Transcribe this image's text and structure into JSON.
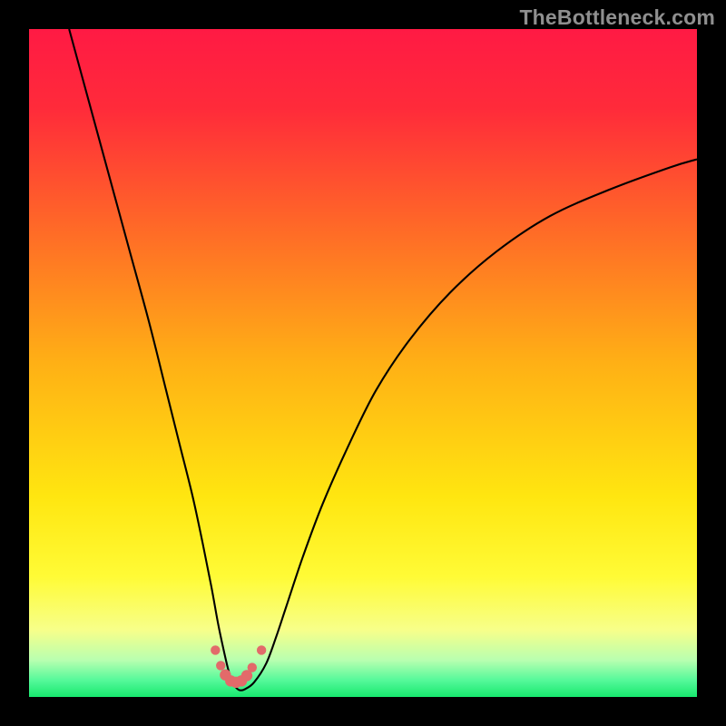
{
  "watermark": "TheBottleneck.com",
  "chart_data": {
    "type": "line",
    "title": "",
    "xlabel": "",
    "ylabel": "",
    "xlim": [
      0,
      100
    ],
    "ylim": [
      0,
      100
    ],
    "gradient_stops": [
      {
        "offset": 0.0,
        "color": "#ff1a44"
      },
      {
        "offset": 0.12,
        "color": "#ff2b3a"
      },
      {
        "offset": 0.3,
        "color": "#ff6a27"
      },
      {
        "offset": 0.5,
        "color": "#ffb015"
      },
      {
        "offset": 0.7,
        "color": "#ffe610"
      },
      {
        "offset": 0.82,
        "color": "#fffb36"
      },
      {
        "offset": 0.9,
        "color": "#f7ff8a"
      },
      {
        "offset": 0.945,
        "color": "#b8ffb0"
      },
      {
        "offset": 0.975,
        "color": "#55f99a"
      },
      {
        "offset": 1.0,
        "color": "#17e86e"
      }
    ],
    "series": [
      {
        "name": "bottleneck-curve",
        "stroke": "#000000",
        "stroke_width": 2.1,
        "x": [
          6,
          9,
          12,
          15,
          18,
          20.5,
          22.5,
          24.5,
          26,
          27.3,
          28.3,
          29.1,
          29.8,
          30.4,
          31.0,
          31.6,
          32.4,
          33.7,
          35.5,
          37.0,
          38.5,
          41,
          44,
          48,
          52,
          57,
          63,
          70,
          78,
          87,
          96,
          100
        ],
        "y": [
          100,
          89,
          78,
          67,
          56,
          46,
          38,
          30,
          23,
          16.5,
          11,
          7.2,
          4.2,
          2.4,
          1.4,
          1.0,
          1.2,
          2.2,
          5.0,
          9.0,
          13.5,
          21,
          29,
          38,
          46,
          53.5,
          60.5,
          66.7,
          72,
          76,
          79.3,
          80.5
        ]
      }
    ],
    "markers": {
      "color": "#e26a6a",
      "radius_large": 6.2,
      "radius_small": 5.2,
      "points": [
        {
          "x": 27.9,
          "y": 7.0,
          "r": "small"
        },
        {
          "x": 28.7,
          "y": 4.7,
          "r": "small"
        },
        {
          "x": 29.4,
          "y": 3.3,
          "r": "large"
        },
        {
          "x": 30.2,
          "y": 2.4,
          "r": "large"
        },
        {
          "x": 31.0,
          "y": 2.2,
          "r": "large"
        },
        {
          "x": 31.8,
          "y": 2.4,
          "r": "large"
        },
        {
          "x": 32.6,
          "y": 3.2,
          "r": "large"
        },
        {
          "x": 33.4,
          "y": 4.4,
          "r": "small"
        },
        {
          "x": 34.8,
          "y": 7.0,
          "r": "small"
        }
      ]
    }
  }
}
